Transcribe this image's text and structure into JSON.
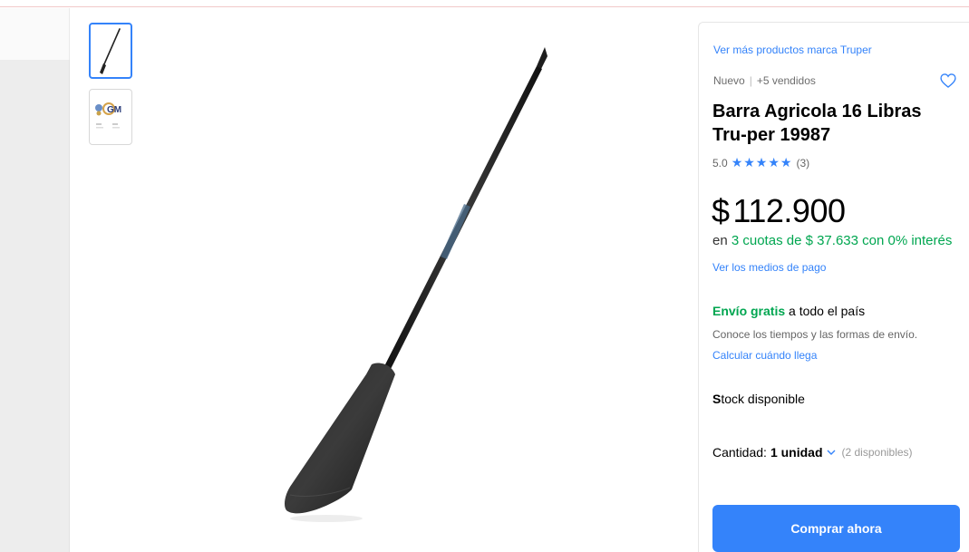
{
  "gallery": {
    "thumbnails": [
      {
        "icon": "bar-tool-thumbnail",
        "selected": true
      },
      {
        "icon": "certification-logos-thumbnail",
        "text": "GM",
        "selected": false
      }
    ]
  },
  "product": {
    "brand_link": "Ver más productos marca Truper",
    "condition": "Nuevo",
    "separator": "|",
    "sold": "+5 vendidos",
    "title": "Barra Agricola 16 Libras Tru-per 19987",
    "rating_value": "5.0",
    "stars": "★★★★★",
    "review_count": "(3)",
    "currency": "$",
    "price": "112.900",
    "installments_prefix": "en",
    "installments_detail": "3 cuotas de $ 37.633 con 0% interés",
    "payment_methods_link": "Ver los medios de pago"
  },
  "shipping": {
    "free_label": "Envío gratis",
    "free_suffix": "a todo el país",
    "note": "Conoce los tiempos y las formas de envío.",
    "calc_link": "Calcular cuándo llega"
  },
  "stock": {
    "first_letter": "S",
    "rest": "tock disponible"
  },
  "quantity": {
    "label": "Cantidad:",
    "value": "1 unidad",
    "available": "(2 disponibles)"
  },
  "actions": {
    "buy_now": "Comprar ahora"
  },
  "colors": {
    "accent": "#3483fa",
    "green": "#00a650"
  }
}
